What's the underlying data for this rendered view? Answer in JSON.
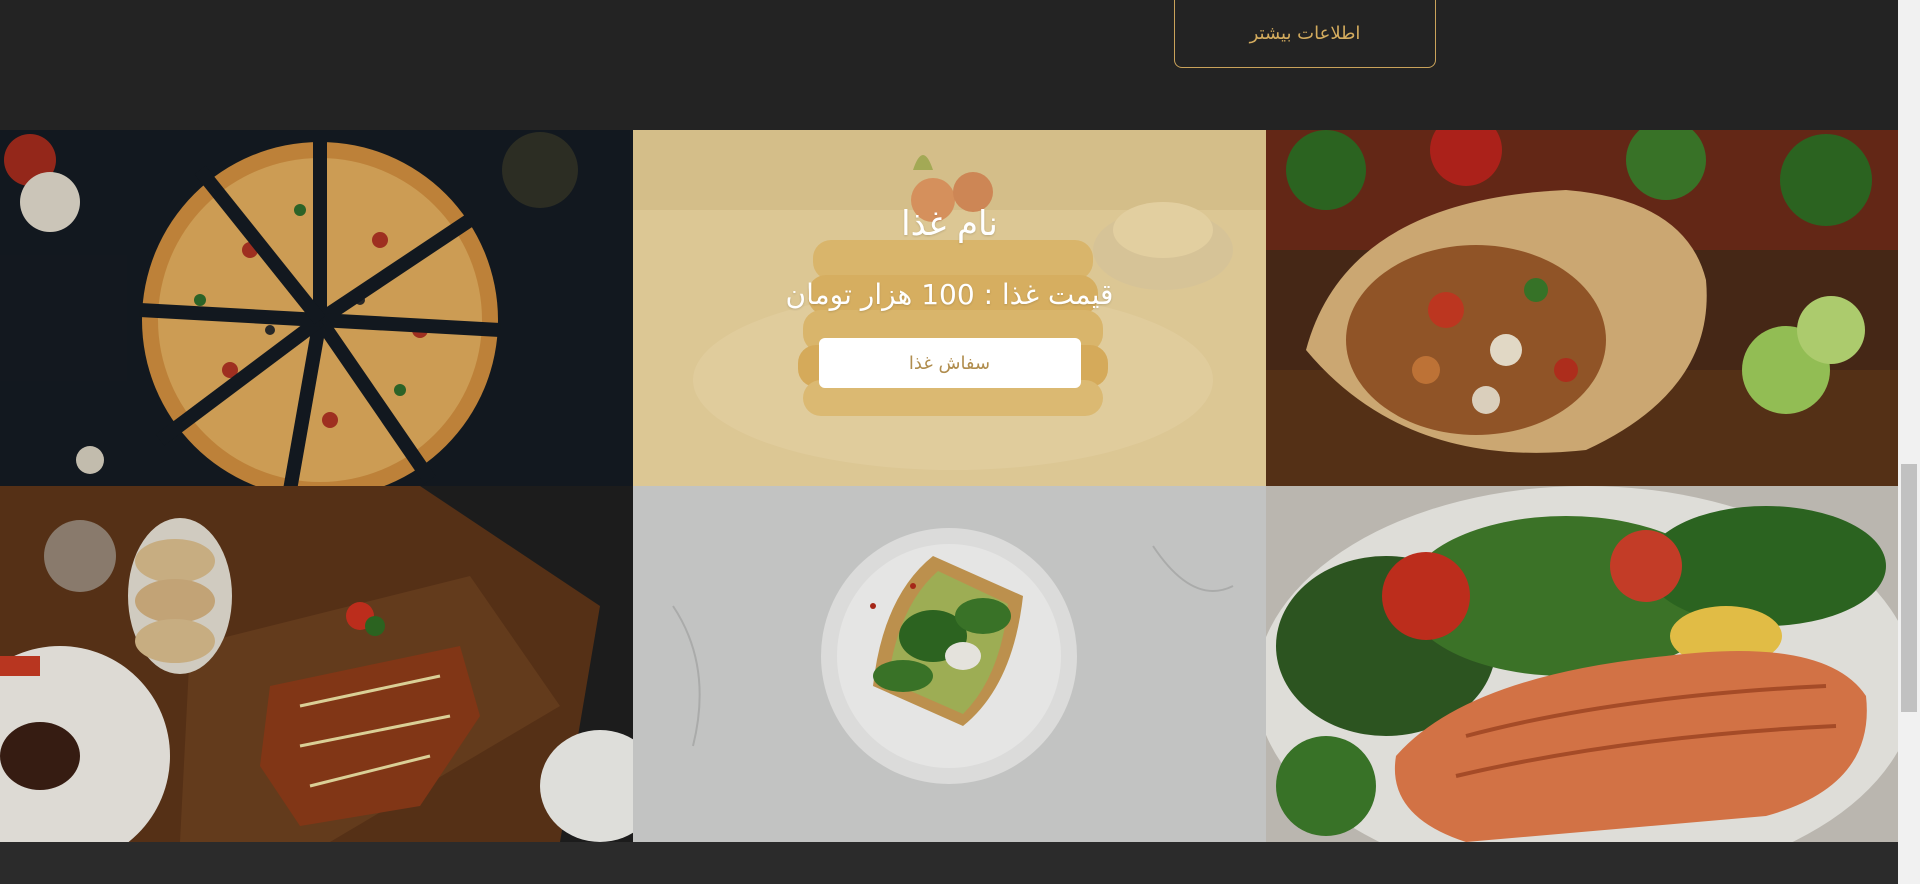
{
  "header": {
    "more_info_label": "اطلاعات بیشتر",
    "accent_color": "#d4ac5e"
  },
  "gallery": {
    "items": [
      {
        "image": "pizza-photo"
      },
      {
        "image": "pancakes-photo",
        "name": "نام غذا",
        "price": "قیمت غذا : 100 هزار تومان",
        "order_label": "سفاش غذا"
      },
      {
        "image": "burrito-photo"
      },
      {
        "image": "grilled-fish-board-photo"
      },
      {
        "image": "avocado-toast-photo"
      },
      {
        "image": "salmon-salad-photo"
      }
    ]
  }
}
